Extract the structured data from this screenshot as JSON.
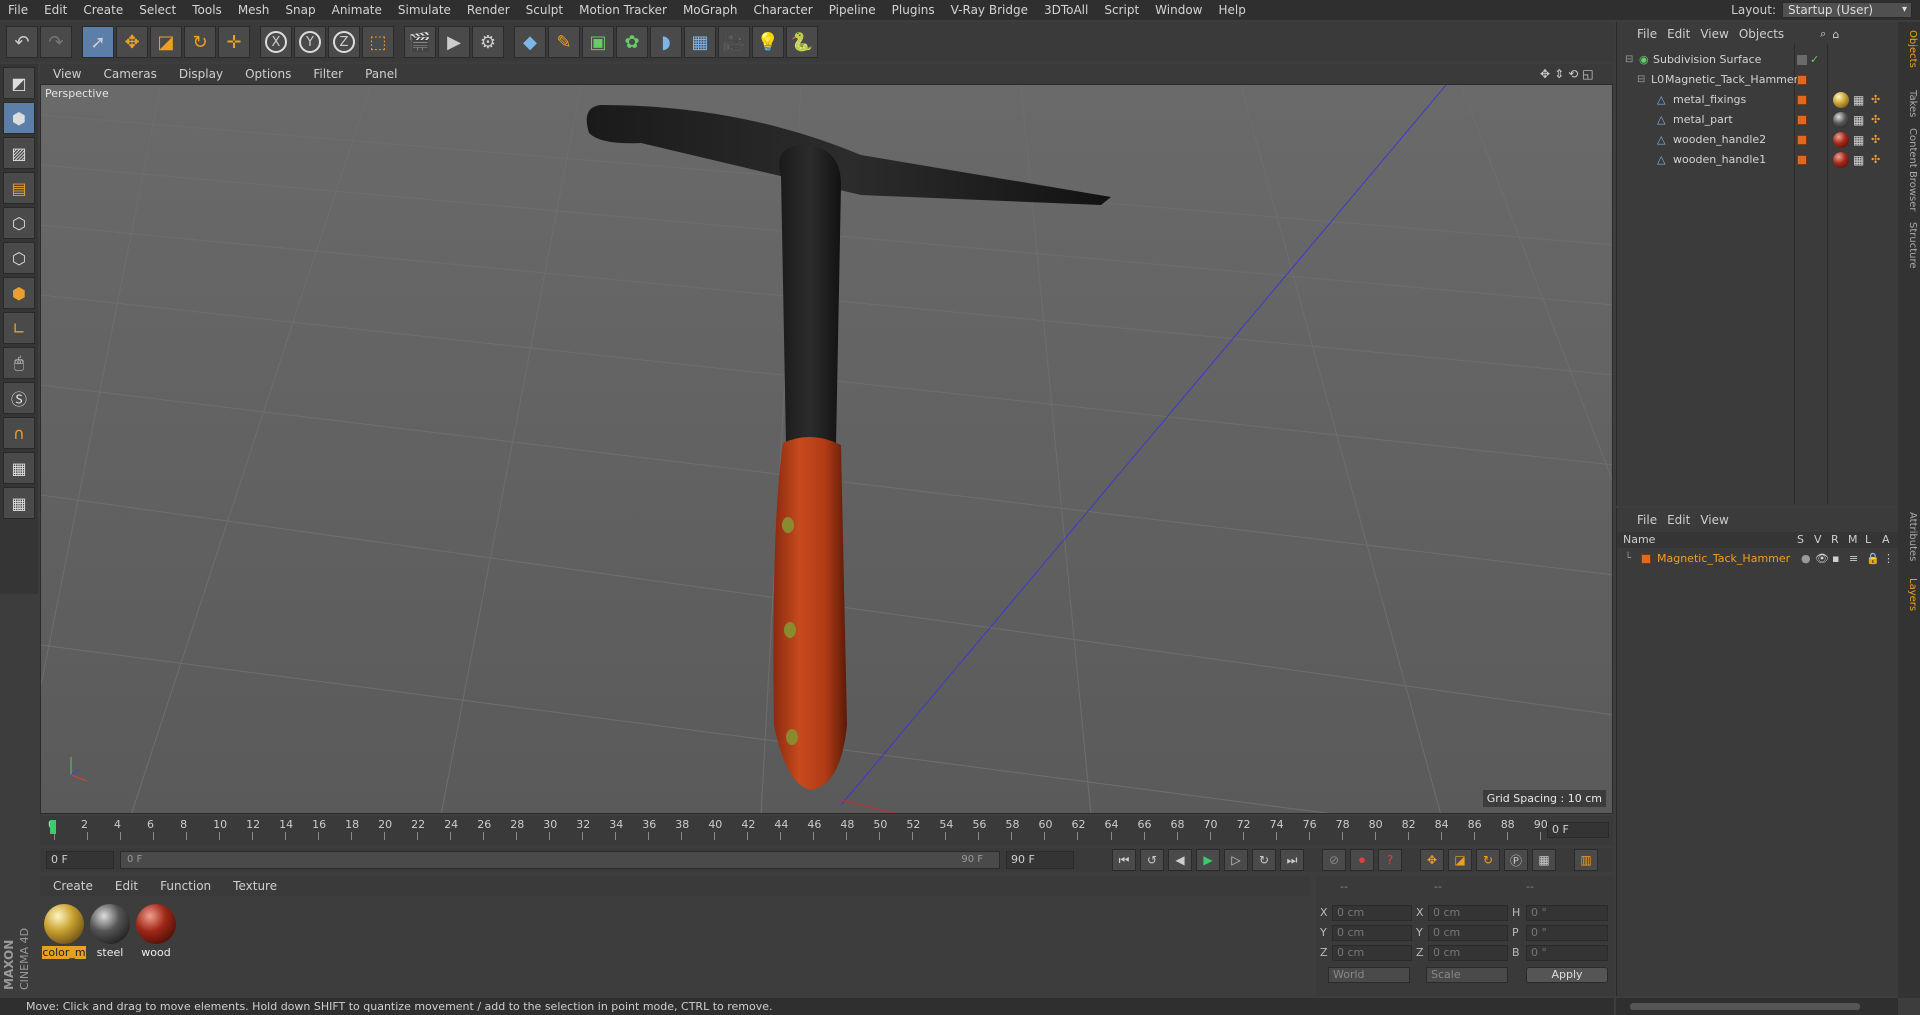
{
  "menu": [
    "File",
    "Edit",
    "Create",
    "Select",
    "Tools",
    "Mesh",
    "Snap",
    "Animate",
    "Simulate",
    "Render",
    "Sculpt",
    "Motion Tracker",
    "MoGraph",
    "Character",
    "Pipeline",
    "Plugins",
    "V-Ray Bridge",
    "3DToAll",
    "Script",
    "Window",
    "Help"
  ],
  "layout": {
    "label": "Layout:",
    "value": "Startup (User)"
  },
  "toolbar": {
    "x_label": "X",
    "y_label": "Y",
    "z_label": "Z"
  },
  "viewport": {
    "menu": [
      "View",
      "Cameras",
      "Display",
      "Options",
      "Filter",
      "Panel"
    ],
    "label": "Perspective",
    "grid_spacing": "Grid Spacing : 10 cm"
  },
  "timeline": {
    "ticks": [
      "0",
      "2",
      "4",
      "6",
      "8",
      "10",
      "12",
      "14",
      "16",
      "18",
      "20",
      "22",
      "24",
      "26",
      "28",
      "30",
      "32",
      "34",
      "36",
      "38",
      "40",
      "42",
      "44",
      "46",
      "48",
      "50",
      "52",
      "54",
      "56",
      "58",
      "60",
      "62",
      "64",
      "66",
      "68",
      "70",
      "72",
      "74",
      "76",
      "78",
      "80",
      "82",
      "84",
      "86",
      "88",
      "90"
    ],
    "current_frame": "0 F",
    "start_field": "0 F",
    "range_start": "0 F",
    "range_end": "90 F",
    "end_field": "90 F"
  },
  "materials": {
    "menu": [
      "Create",
      "Edit",
      "Function",
      "Texture"
    ],
    "items": [
      {
        "name": "color_m",
        "color": "#c8a030"
      },
      {
        "name": "steel",
        "color": "#555555"
      },
      {
        "name": "wood",
        "color": "#a02818"
      }
    ]
  },
  "coordinates": {
    "header1": "--",
    "header2": "--",
    "header3": "--",
    "rows": [
      {
        "a": "X",
        "av": "0 cm",
        "b": "X",
        "bv": "0 cm",
        "c": "H",
        "cv": "0 °"
      },
      {
        "a": "Y",
        "av": "0 cm",
        "b": "Y",
        "bv": "0 cm",
        "c": "P",
        "cv": "0 °"
      },
      {
        "a": "Z",
        "av": "0 cm",
        "b": "Z",
        "bv": "0 cm",
        "c": "B",
        "cv": "0 °"
      }
    ],
    "world": "World",
    "scale": "Scale",
    "apply": "Apply"
  },
  "objects": {
    "menu": [
      "File",
      "Edit",
      "View",
      "Objects"
    ],
    "items": [
      {
        "name": "Subdivision Surface",
        "indent": 0
      },
      {
        "name": "Magnetic_Tack_Hammer",
        "indent": 1
      },
      {
        "name": "metal_fixings",
        "indent": 2
      },
      {
        "name": "metal_part",
        "indent": 2
      },
      {
        "name": "wooden_handle2",
        "indent": 2
      },
      {
        "name": "wooden_handle1",
        "indent": 2
      }
    ]
  },
  "layers": {
    "menu": [
      "File",
      "Edit",
      "View"
    ],
    "columns": [
      "Name",
      "S",
      "V",
      "R",
      "M",
      "L",
      "A"
    ],
    "item": "Magnetic_Tack_Hammer"
  },
  "sidetabs": [
    "Objects",
    "Takes",
    "Content Browser",
    "Structure",
    "Attributes",
    "Layers"
  ],
  "status": "Move: Click and drag to move elements. Hold down SHIFT to quantize movement / add to the selection in point mode, CTRL to remove.",
  "brand": {
    "line1": "MAXON",
    "line2": "CINEMA 4D"
  }
}
